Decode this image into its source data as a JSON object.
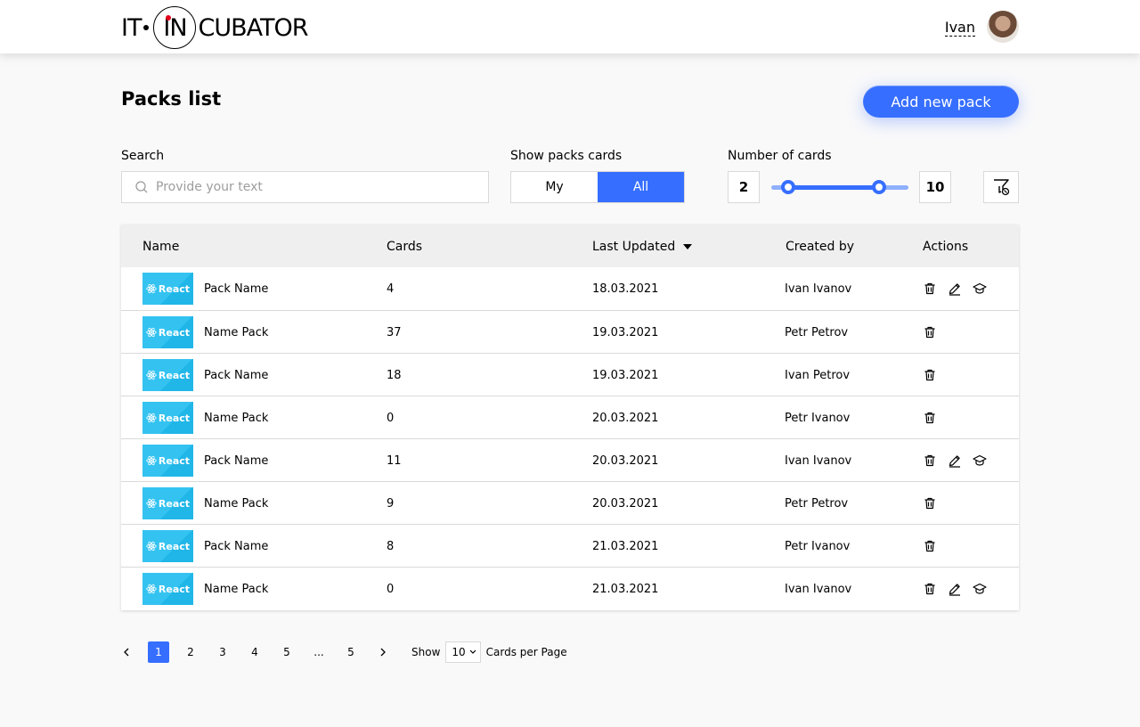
{
  "header": {
    "logo": {
      "left": "IT",
      "circle": "IN",
      "right": "CUBATOR"
    },
    "user_name": "Ivan"
  },
  "page": {
    "title": "Packs list",
    "add_button": "Add new pack"
  },
  "filters": {
    "search_label": "Search",
    "search_placeholder": "Provide your text",
    "show_label": "Show packs cards",
    "toggle_my": "My",
    "toggle_all": "All",
    "toggle_selected": "All",
    "number_label": "Number of cards",
    "min": "2",
    "max": "10"
  },
  "table": {
    "headers": {
      "name": "Name",
      "cards": "Cards",
      "updated": "Last Updated",
      "created": "Created by",
      "actions": "Actions"
    },
    "rows": [
      {
        "cover": "React",
        "name": "Pack Name",
        "cards": "4",
        "updated": "18.03.2021",
        "created": "Ivan Ivanov",
        "actions": [
          "trash-icon",
          "edit-icon",
          "learn-icon"
        ]
      },
      {
        "cover": "React",
        "name": "Name Pack",
        "cards": "37",
        "updated": "19.03.2021",
        "created": "Petr Petrov",
        "actions": [
          "trash-icon"
        ]
      },
      {
        "cover": "React",
        "name": "Pack Name",
        "cards": "18",
        "updated": "19.03.2021",
        "created": "Ivan Petrov",
        "actions": [
          "trash-icon"
        ]
      },
      {
        "cover": "React",
        "name": "Name Pack",
        "cards": "0",
        "updated": "20.03.2021",
        "created": "Petr Ivanov",
        "actions": [
          "trash-icon"
        ]
      },
      {
        "cover": "React",
        "name": "Pack Name",
        "cards": "11",
        "updated": "20.03.2021",
        "created": "Ivan Ivanov",
        "actions": [
          "trash-icon",
          "edit-icon",
          "learn-icon"
        ]
      },
      {
        "cover": "React",
        "name": "Name Pack",
        "cards": "9",
        "updated": "20.03.2021",
        "created": "Petr Petrov",
        "actions": [
          "trash-icon"
        ]
      },
      {
        "cover": "React",
        "name": "Pack Name",
        "cards": "8",
        "updated": "21.03.2021",
        "created": "Petr Ivanov",
        "actions": [
          "trash-icon"
        ]
      },
      {
        "cover": "React",
        "name": "Name Pack",
        "cards": "0",
        "updated": "21.03.2021",
        "created": "Ivan Ivanov",
        "actions": [
          "trash-icon",
          "edit-icon",
          "learn-icon"
        ]
      }
    ]
  },
  "pagination": {
    "pages": [
      "1",
      "2",
      "3",
      "4",
      "5",
      "...",
      "5"
    ],
    "current": "1",
    "show_label": "Show",
    "per_page": "10",
    "per_page_suffix": "Cards per Page"
  },
  "colors": {
    "accent": "#366eff"
  }
}
